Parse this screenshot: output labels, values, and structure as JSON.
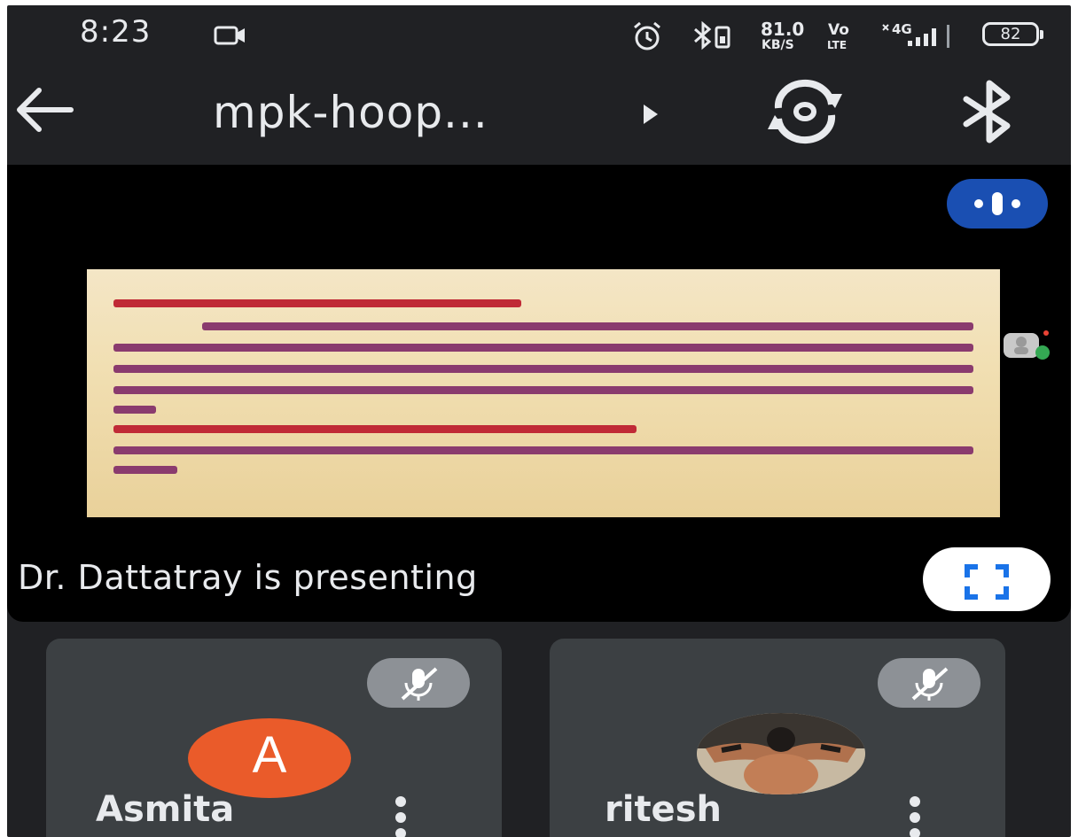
{
  "status_bar": {
    "time": "8:23",
    "net_speed_value": "81.0",
    "net_speed_unit": "KB/S",
    "volte_top": "Vo",
    "volte_bottom": "LTE",
    "network": "4G",
    "battery": "82"
  },
  "app_bar": {
    "meeting_title": "mpk-hoop..."
  },
  "stage": {
    "presenter_text": "Dr. Dattatray is presenting"
  },
  "participants": [
    {
      "name": "Asmita",
      "avatar_letter": "A",
      "mic": "muted"
    },
    {
      "name": "ritesh",
      "mic": "muted"
    }
  ],
  "colors": {
    "background": "#202124",
    "stage": "#000000",
    "tile": "#3c4043",
    "speaking_indicator": "#1a4fb2",
    "avatar_asmita": "#ea5b2a",
    "slide_text": "#b3232e"
  }
}
